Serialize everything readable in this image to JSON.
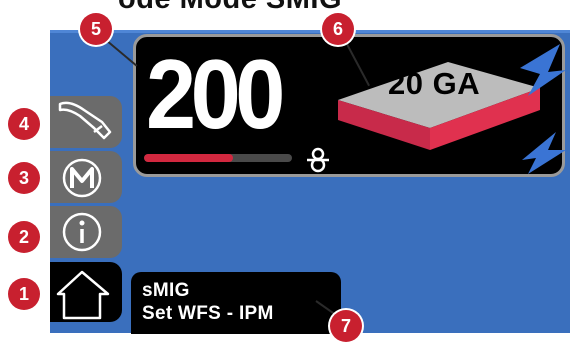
{
  "heading": "ode Mode SMIG",
  "display": {
    "wfs_value": "200",
    "wfs_fill": 0.6,
    "material_thickness": "20 GA"
  },
  "status": {
    "line1": "sMIG",
    "line2": "Set WFS - IPM"
  },
  "markers": [
    "1",
    "2",
    "3",
    "4",
    "5",
    "6",
    "7"
  ],
  "colors": {
    "screen": "#3a6fbd",
    "accent_red": "#d2283f",
    "marker": "#c8202f",
    "arrow_blue": "#3a74d4"
  },
  "icons": {
    "home": "home-icon",
    "info": "info-icon",
    "memory": "memory-m-icon",
    "torch": "torch-icon",
    "dial": "dial-icon"
  }
}
